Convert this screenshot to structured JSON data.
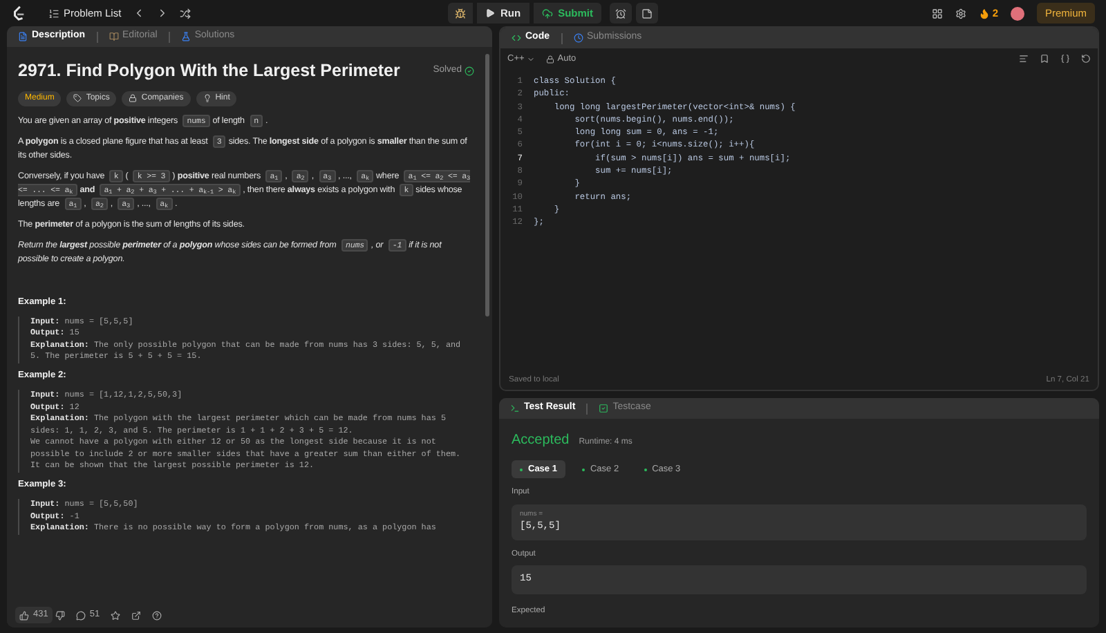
{
  "topbar": {
    "problem_list": "Problem List",
    "run": "Run",
    "submit": "Submit",
    "streak": "2",
    "premium": "Premium"
  },
  "left_tabs": [
    {
      "label": "Description",
      "selected": true
    },
    {
      "label": "Editorial",
      "selected": false
    },
    {
      "label": "Solutions",
      "selected": false
    }
  ],
  "problem": {
    "title": "2971. Find Polygon With the Largest Perimeter",
    "status": "Solved",
    "tags": [
      {
        "label": "Medium",
        "kind": "difficulty"
      },
      {
        "label": "Topics",
        "kind": "tag"
      },
      {
        "label": "Companies",
        "kind": "lock"
      },
      {
        "label": "Hint",
        "kind": "bulb"
      }
    ],
    "paragraphs": [
      {
        "italic": false,
        "parts": [
          {
            "kind": "text",
            "text": "You are given an array of **positive** integers"
          },
          {
            "kind": "code",
            "text": "nums"
          },
          {
            "kind": "text",
            "text": "of length"
          },
          {
            "kind": "code",
            "text": "n"
          },
          {
            "kind": "text",
            "text": "."
          }
        ]
      },
      {
        "italic": false,
        "parts": [
          {
            "kind": "text",
            "text": "A **polygon** is a closed plane figure that has at least"
          },
          {
            "kind": "code",
            "text": "3"
          },
          {
            "kind": "text",
            "text": "sides. The **longest side** of a polygon is **smaller** than the sum of its other sides."
          }
        ]
      },
      {
        "italic": false,
        "parts": [
          {
            "kind": "text",
            "text": "Conversely, if you have"
          },
          {
            "kind": "code",
            "text": "k"
          },
          {
            "kind": "text",
            "text": "("
          },
          {
            "kind": "code",
            "text": "k >= 3"
          },
          {
            "kind": "text",
            "text": ") **positive** real numbers"
          },
          {
            "kind": "code",
            "text": "a$_{1}$"
          },
          {
            "kind": "text",
            "text": ","
          },
          {
            "kind": "code",
            "text": "a$_{2}$"
          },
          {
            "kind": "text",
            "text": ","
          },
          {
            "kind": "code",
            "text": "a$_{3}$"
          },
          {
            "kind": "text",
            "text": ", ...,"
          },
          {
            "kind": "code",
            "text": "a$_{k}$"
          },
          {
            "kind": "text",
            "text": "where"
          },
          {
            "kind": "code",
            "text": "a$_{1}$ <= a$_{2}$ <= a$_{3}$ <= ... <= a$_{k}$"
          },
          {
            "kind": "text",
            "text": "**and**"
          },
          {
            "kind": "code",
            "text": "a$_{1}$ + a$_{2}$ + a$_{3}$ + ... + a$_{k-1}$ > a$_{k}$"
          },
          {
            "kind": "text",
            "text": ", then there **always** exists a polygon with"
          },
          {
            "kind": "code",
            "text": "k"
          },
          {
            "kind": "text",
            "text": "sides whose lengths are"
          },
          {
            "kind": "code",
            "text": "a$_{1}$"
          },
          {
            "kind": "text",
            "text": ","
          },
          {
            "kind": "code",
            "text": "a$_{2}$"
          },
          {
            "kind": "text",
            "text": ","
          },
          {
            "kind": "code",
            "text": "a$_{3}$"
          },
          {
            "kind": "text",
            "text": ", ...,"
          },
          {
            "kind": "code",
            "text": "a$_{k}$"
          },
          {
            "kind": "text",
            "text": "."
          }
        ]
      },
      {
        "italic": false,
        "parts": [
          {
            "kind": "text",
            "text": "The **perimeter** of a polygon is the sum of lengths of its sides."
          }
        ]
      },
      {
        "italic": true,
        "parts": [
          {
            "kind": "text",
            "text": "Return the **largest** possible **perimeter** of a **polygon** whose sides can be formed from"
          },
          {
            "kind": "code",
            "text": "nums"
          },
          {
            "kind": "text",
            "text": ", or"
          },
          {
            "kind": "code",
            "text": "-1"
          },
          {
            "kind": "text",
            "text": "if it is not possible to create a polygon."
          }
        ]
      }
    ],
    "examples": [
      {
        "title": "Example 1:",
        "lines": [
          {
            "label": "Input:",
            "text": "nums = [5,5,5]"
          },
          {
            "label": "Output:",
            "text": "15"
          },
          {
            "label": "Explanation:",
            "text": "The only possible polygon that can be made from nums has 3 sides: 5, 5, and 5. The perimeter is 5 + 5 + 5 = 15."
          }
        ]
      },
      {
        "title": "Example 2:",
        "lines": [
          {
            "label": "Input:",
            "text": "nums = [1,12,1,2,5,50,3]"
          },
          {
            "label": "Output:",
            "text": "12"
          },
          {
            "label": "Explanation:",
            "text": "The polygon with the largest perimeter which can be made from nums has 5 sides: 1, 1, 2, 3, and 5. The perimeter is 1 + 1 + 2 + 3 + 5 = 12."
          },
          {
            "text": "We cannot have a polygon with either 12 or 50 as the longest side because it is not possible to include 2 or more smaller sides that have a greater sum than either of them."
          },
          {
            "text": "It can be shown that the largest possible perimeter is 12."
          }
        ]
      },
      {
        "title": "Example 3:",
        "lines": [
          {
            "label": "Input:",
            "text": "nums = [5,5,50]"
          },
          {
            "label": "Output:",
            "text": "-1"
          },
          {
            "label": "Explanation:",
            "text": "There is no possible way to form a polygon from nums, as a polygon has"
          }
        ]
      }
    ],
    "footer": {
      "likes": "431",
      "comments": "51"
    }
  },
  "code_panel": {
    "tabs": [
      {
        "label": "Code",
        "selected": true
      },
      {
        "label": "Submissions",
        "selected": false
      }
    ],
    "language": "C++",
    "mode": "Auto",
    "lines": [
      {
        "number": "1",
        "code": "class Solution {",
        "active": false
      },
      {
        "number": "2",
        "code": "public:",
        "active": false
      },
      {
        "number": "3",
        "code": "    long long largestPerimeter(vector<int>& nums) {",
        "active": false
      },
      {
        "number": "4",
        "code": "        sort(nums.begin(), nums.end());",
        "active": false
      },
      {
        "number": "5",
        "code": "        long long sum = 0, ans = -1;",
        "active": false
      },
      {
        "number": "6",
        "code": "        for(int i = 0; i<nums.size(); i++){",
        "active": false
      },
      {
        "number": "7",
        "code": "            if(sum > nums[i]) ans = sum + nums[i];",
        "active": true
      },
      {
        "number": "8",
        "code": "            sum += nums[i];",
        "active": false
      },
      {
        "number": "9",
        "code": "        }",
        "active": false
      },
      {
        "number": "10",
        "code": "        return ans;",
        "active": false
      },
      {
        "number": "11",
        "code": "    }",
        "active": false
      },
      {
        "number": "12",
        "code": "};",
        "active": false
      }
    ],
    "saved": "Saved to local",
    "cursor": "Ln 7, Col 21"
  },
  "result_panel": {
    "tabs": [
      {
        "label": "Test Result",
        "selected": true
      },
      {
        "label": "Testcase",
        "selected": false
      }
    ],
    "verdict": "Accepted",
    "runtime": "Runtime: 4 ms",
    "cases": [
      {
        "label": "Case 1",
        "selected": true
      },
      {
        "label": "Case 2",
        "selected": false
      },
      {
        "label": "Case 3",
        "selected": false
      }
    ],
    "input_label": "Input",
    "input_name": "nums =",
    "input_value": "[5,5,5]",
    "output_label": "Output",
    "output_value": "15",
    "expected_label": "Expected"
  }
}
